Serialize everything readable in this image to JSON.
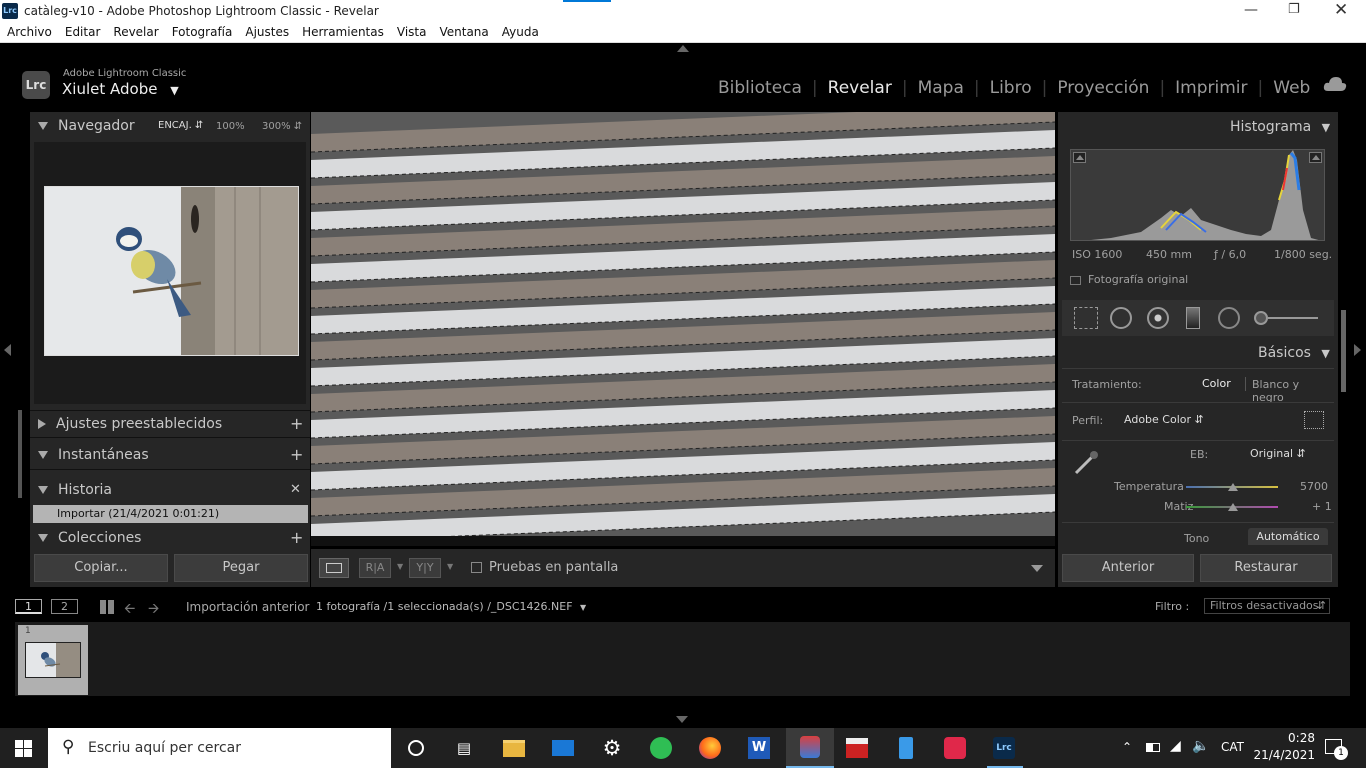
{
  "window": {
    "title": "catàleg-v10 - Adobe Photoshop Lightroom Classic - Revelar",
    "app_icon": "Lrc"
  },
  "menu": [
    "Archivo",
    "Editar",
    "Revelar",
    "Fotografía",
    "Ajustes",
    "Herramientas",
    "Vista",
    "Ventana",
    "Ayuda"
  ],
  "identity": {
    "product": "Adobe Lightroom Classic",
    "user": "Xiulet Adobe",
    "logo": "Lrc"
  },
  "modules": [
    {
      "label": "Biblioteca",
      "active": false
    },
    {
      "label": "Revelar",
      "active": true
    },
    {
      "label": "Mapa",
      "active": false
    },
    {
      "label": "Libro",
      "active": false
    },
    {
      "label": "Proyección",
      "active": false
    },
    {
      "label": "Imprimir",
      "active": false
    },
    {
      "label": "Web",
      "active": false
    }
  ],
  "left": {
    "navigator": {
      "title": "Navegador",
      "fit": "ENCAJ.",
      "zoom1": "100%",
      "zoom2": "300%"
    },
    "presets": "Ajustes preestablecidos",
    "snapshots": "Instantáneas",
    "history": {
      "title": "Historia",
      "item": "Importar (21/4/2021 0:01:21)"
    },
    "collections": "Colecciones",
    "copy_btn": "Copiar...",
    "paste_btn": "Pegar"
  },
  "toolbar": {
    "soft_proof": "Pruebas en pantalla",
    "view_ra": "R|A",
    "view_yy": "Y|Y"
  },
  "right": {
    "histogram": {
      "title": "Histograma",
      "iso": "ISO 1600",
      "focal": "450 mm",
      "aperture": "ƒ / 6,0",
      "shutter": "1/800 seg.",
      "original": "Fotografía original"
    },
    "basic": {
      "title": "Básicos",
      "treatment_label": "Tratamiento:",
      "treatment_color": "Color",
      "treatment_bw": "Blanco y negro",
      "profile_label": "Perfil:",
      "profile_value": "Adobe Color",
      "wb_label": "EB:",
      "wb_value": "Original",
      "temp_label": "Temperatura",
      "temp_value": "5700",
      "temp_fraction": 0.51,
      "tint_label": "Matiz",
      "tint_value": "+ 1",
      "tint_fraction": 0.51,
      "tone_label": "Tono",
      "auto_btn": "Automático"
    },
    "prev_btn": "Anterior",
    "reset_btn": "Restaurar"
  },
  "filmstrip": {
    "page1": "1",
    "page2": "2",
    "source": "Importación anterior",
    "info": "1 fotografía /1 seleccionada(s) /_DSC1426.NEF",
    "filter_label": "Filtro :",
    "filter_value": "Filtros desactivados",
    "thumb_index": "1"
  },
  "taskbar": {
    "search_placeholder": "Escriu aquí per cercar",
    "lang": "CAT",
    "time": "0:28",
    "date": "21/4/2021",
    "notif": "1",
    "word_icon": "W",
    "lrc_icon": "Lrc"
  },
  "colors": {
    "accent": "#0078d7",
    "panel": "#262626",
    "bg": "#000000",
    "taskbar": "#202020"
  }
}
